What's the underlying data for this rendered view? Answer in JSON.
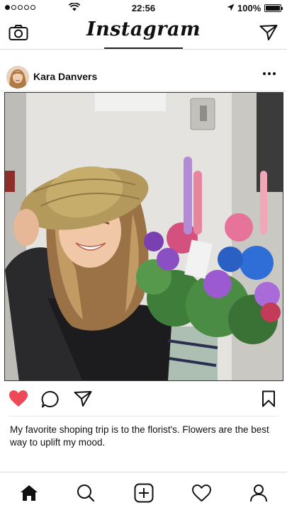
{
  "status_bar": {
    "time": "22:56",
    "battery": "100%",
    "signal_bars": 1,
    "signal_total": 5
  },
  "nav": {
    "brand": "Instagram",
    "left_icon": "camera-icon",
    "right_icon": "direct-message-icon"
  },
  "post": {
    "username": "Kara Danvers",
    "more_icon": "more-options-icon",
    "caption": "My favorite shoping trip is to the florist's. Flowers are the best way to uplift my mood.",
    "liked": true,
    "colors": {
      "like": "#ed4956"
    }
  },
  "tab_bar": {
    "items": [
      "home-icon",
      "search-icon",
      "add-post-icon",
      "activity-heart-icon",
      "profile-icon"
    ],
    "active": "home-icon"
  }
}
